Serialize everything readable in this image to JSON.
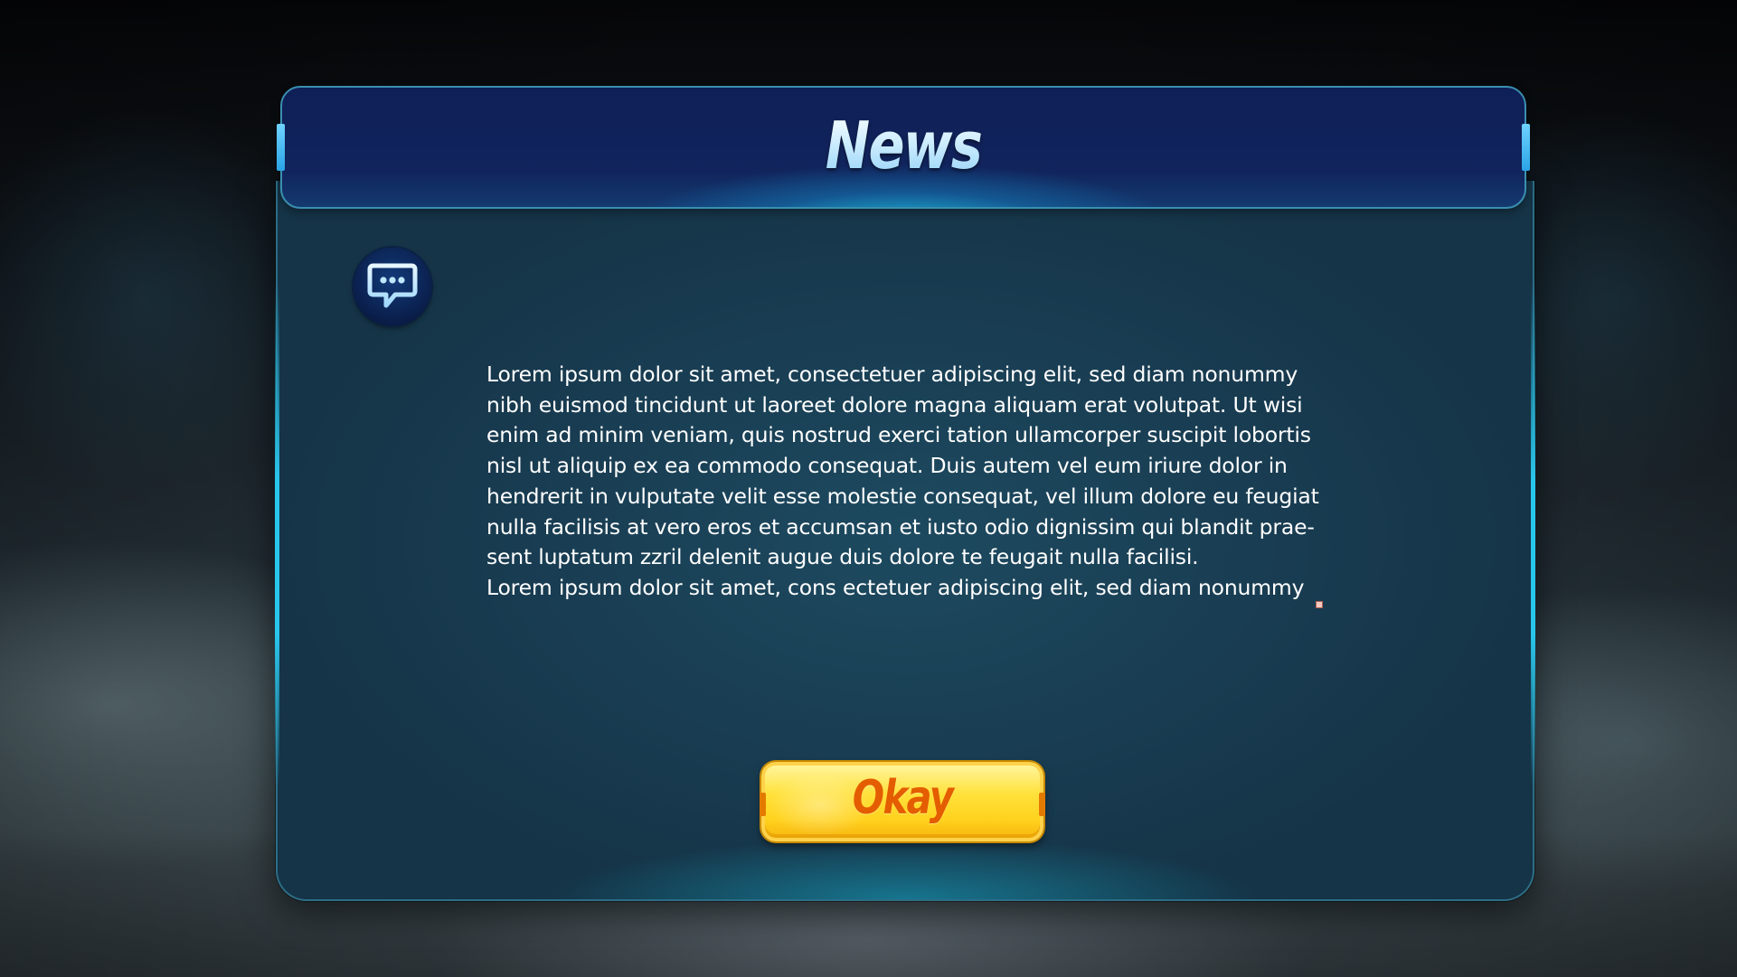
{
  "dialog": {
    "title": "News",
    "icon": "chat-bubble-icon",
    "paragraphs": [
      "Lorem ipsum dolor sit amet, consectetuer adipiscing elit, sed diam nonummy\nnibh euismod tincidunt ut laoreet dolore magna aliquam erat volutpat. Ut wisi\nenim ad minim veniam, quis nostrud exerci tation ullamcorper suscipit lobortis\nnisl ut aliquip ex ea commodo consequat. Duis autem vel eum iriure dolor in\nhendrerit in vulputate velit esse molestie consequat, vel illum dolore eu feugiat\nnulla facilisis at vero eros et accumsan et iusto odio dignissim qui blandit prae-\nsent luptatum zzril delenit augue duis dolore te feugait nulla facilisi.",
      "Lorem ipsum dolor sit amet, cons ectetuer adipiscing elit, sed diam nonummy"
    ],
    "button_label": "Okay"
  },
  "colors": {
    "panel": "#183a4f",
    "header": "#11245c",
    "accent": "#29c6ec",
    "button": "#ffd21e",
    "button_text": "#e45d00"
  }
}
